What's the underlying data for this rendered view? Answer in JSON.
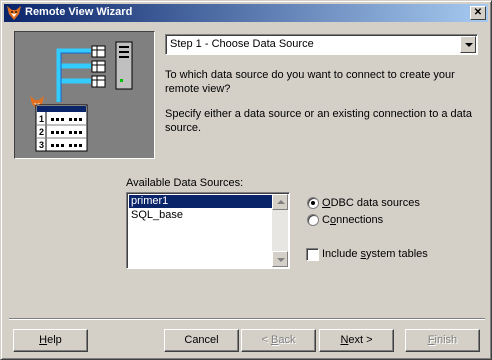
{
  "window": {
    "title": "Remote View Wizard"
  },
  "step_combo": {
    "value": "Step 1 - Choose Data Source"
  },
  "description": {
    "question": "To which data source do you want to connect to create your remote view?",
    "instruction": "Specify either a data source or an existing connection to a data source."
  },
  "illustration": {
    "rows": [
      "1",
      "2",
      "3"
    ]
  },
  "sources": {
    "label": "Available Data Sources:",
    "items": [
      {
        "label": "primer1",
        "selected": true
      },
      {
        "label": "SQL_base",
        "selected": false
      }
    ]
  },
  "options": {
    "odbc_label": "ODBC data sources",
    "odbc_checked": true,
    "connections_label": "Connections",
    "connections_checked": false,
    "system_tables_label": "Include system tables",
    "system_tables_checked": false
  },
  "buttons": {
    "help": "Help",
    "cancel": "Cancel",
    "back": "< Back",
    "next": "Next >",
    "finish": "Finish"
  },
  "colors": {
    "titlebar": "#0a246a",
    "selection": "#0a246a",
    "face": "#d4d0c8",
    "illustration_bg": "#808080",
    "pipe": "#33ccff"
  }
}
